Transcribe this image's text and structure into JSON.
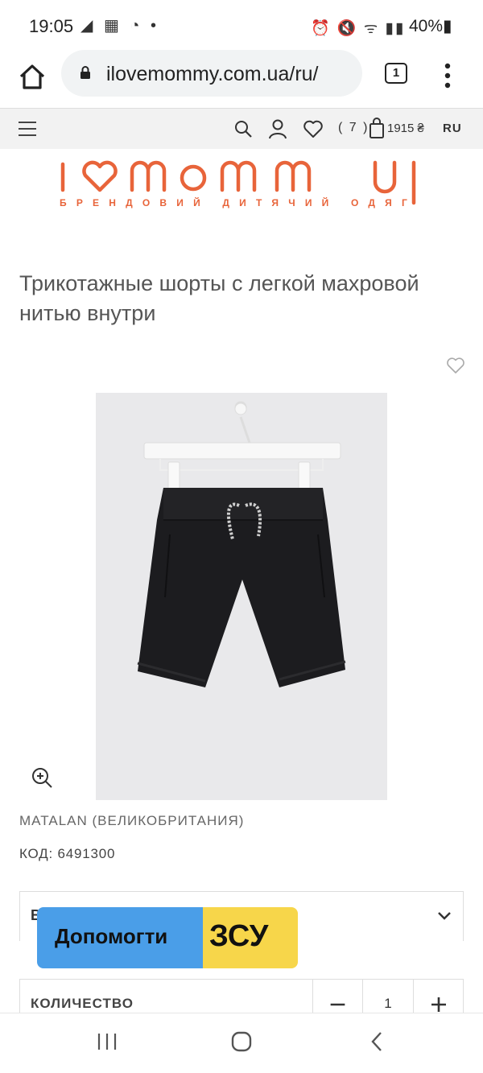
{
  "status_bar": {
    "time": "19:05",
    "left_icons": "◢ ▦ ◔ •",
    "right_icons": "⏰ 🔇 ᯤ ▮▮",
    "battery": "40%▮"
  },
  "browser": {
    "url": "ilovemommy.com.ua/ru/",
    "tab_count": "1",
    "icons": [
      "home-icon",
      "lock-icon",
      "tabs-icon",
      "more-vert-icon"
    ]
  },
  "site_header": {
    "cart_count": "( 7 )",
    "cart_total": "1915 ₴",
    "language": "RU",
    "icons": [
      "hamburger-icon",
      "search-icon",
      "user-icon",
      "heart-icon",
      "shopping-bag-icon"
    ]
  },
  "logo": {
    "wordmark": "i♥mommy",
    "tagline": "БРЕНДОВИЙ ДИТЯЧИЙ ОДЯГ",
    "color": "#e8643a"
  },
  "product": {
    "title": "Трикотажные шорты с легкой махровой нитью внутри",
    "brand": "MATALAN (ВЕЛИКОБРИТАНИЯ)",
    "sku": "КОД: 6491300",
    "image_alt": "black-shorts-on-hanger"
  },
  "accordion": {
    "label_visible": "В"
  },
  "banner": {
    "part1": "Допомогти",
    "part2": "ЗСУ",
    "colors": {
      "left": "#4a9ee8",
      "right": "#f7d64a"
    }
  },
  "quantity": {
    "label": "КОЛИЧЕСТВО",
    "value": "1",
    "minus": "−",
    "plus": "+"
  },
  "nav_bar": {
    "icons": [
      "recent-apps-icon",
      "home-circle-icon",
      "back-icon"
    ]
  }
}
